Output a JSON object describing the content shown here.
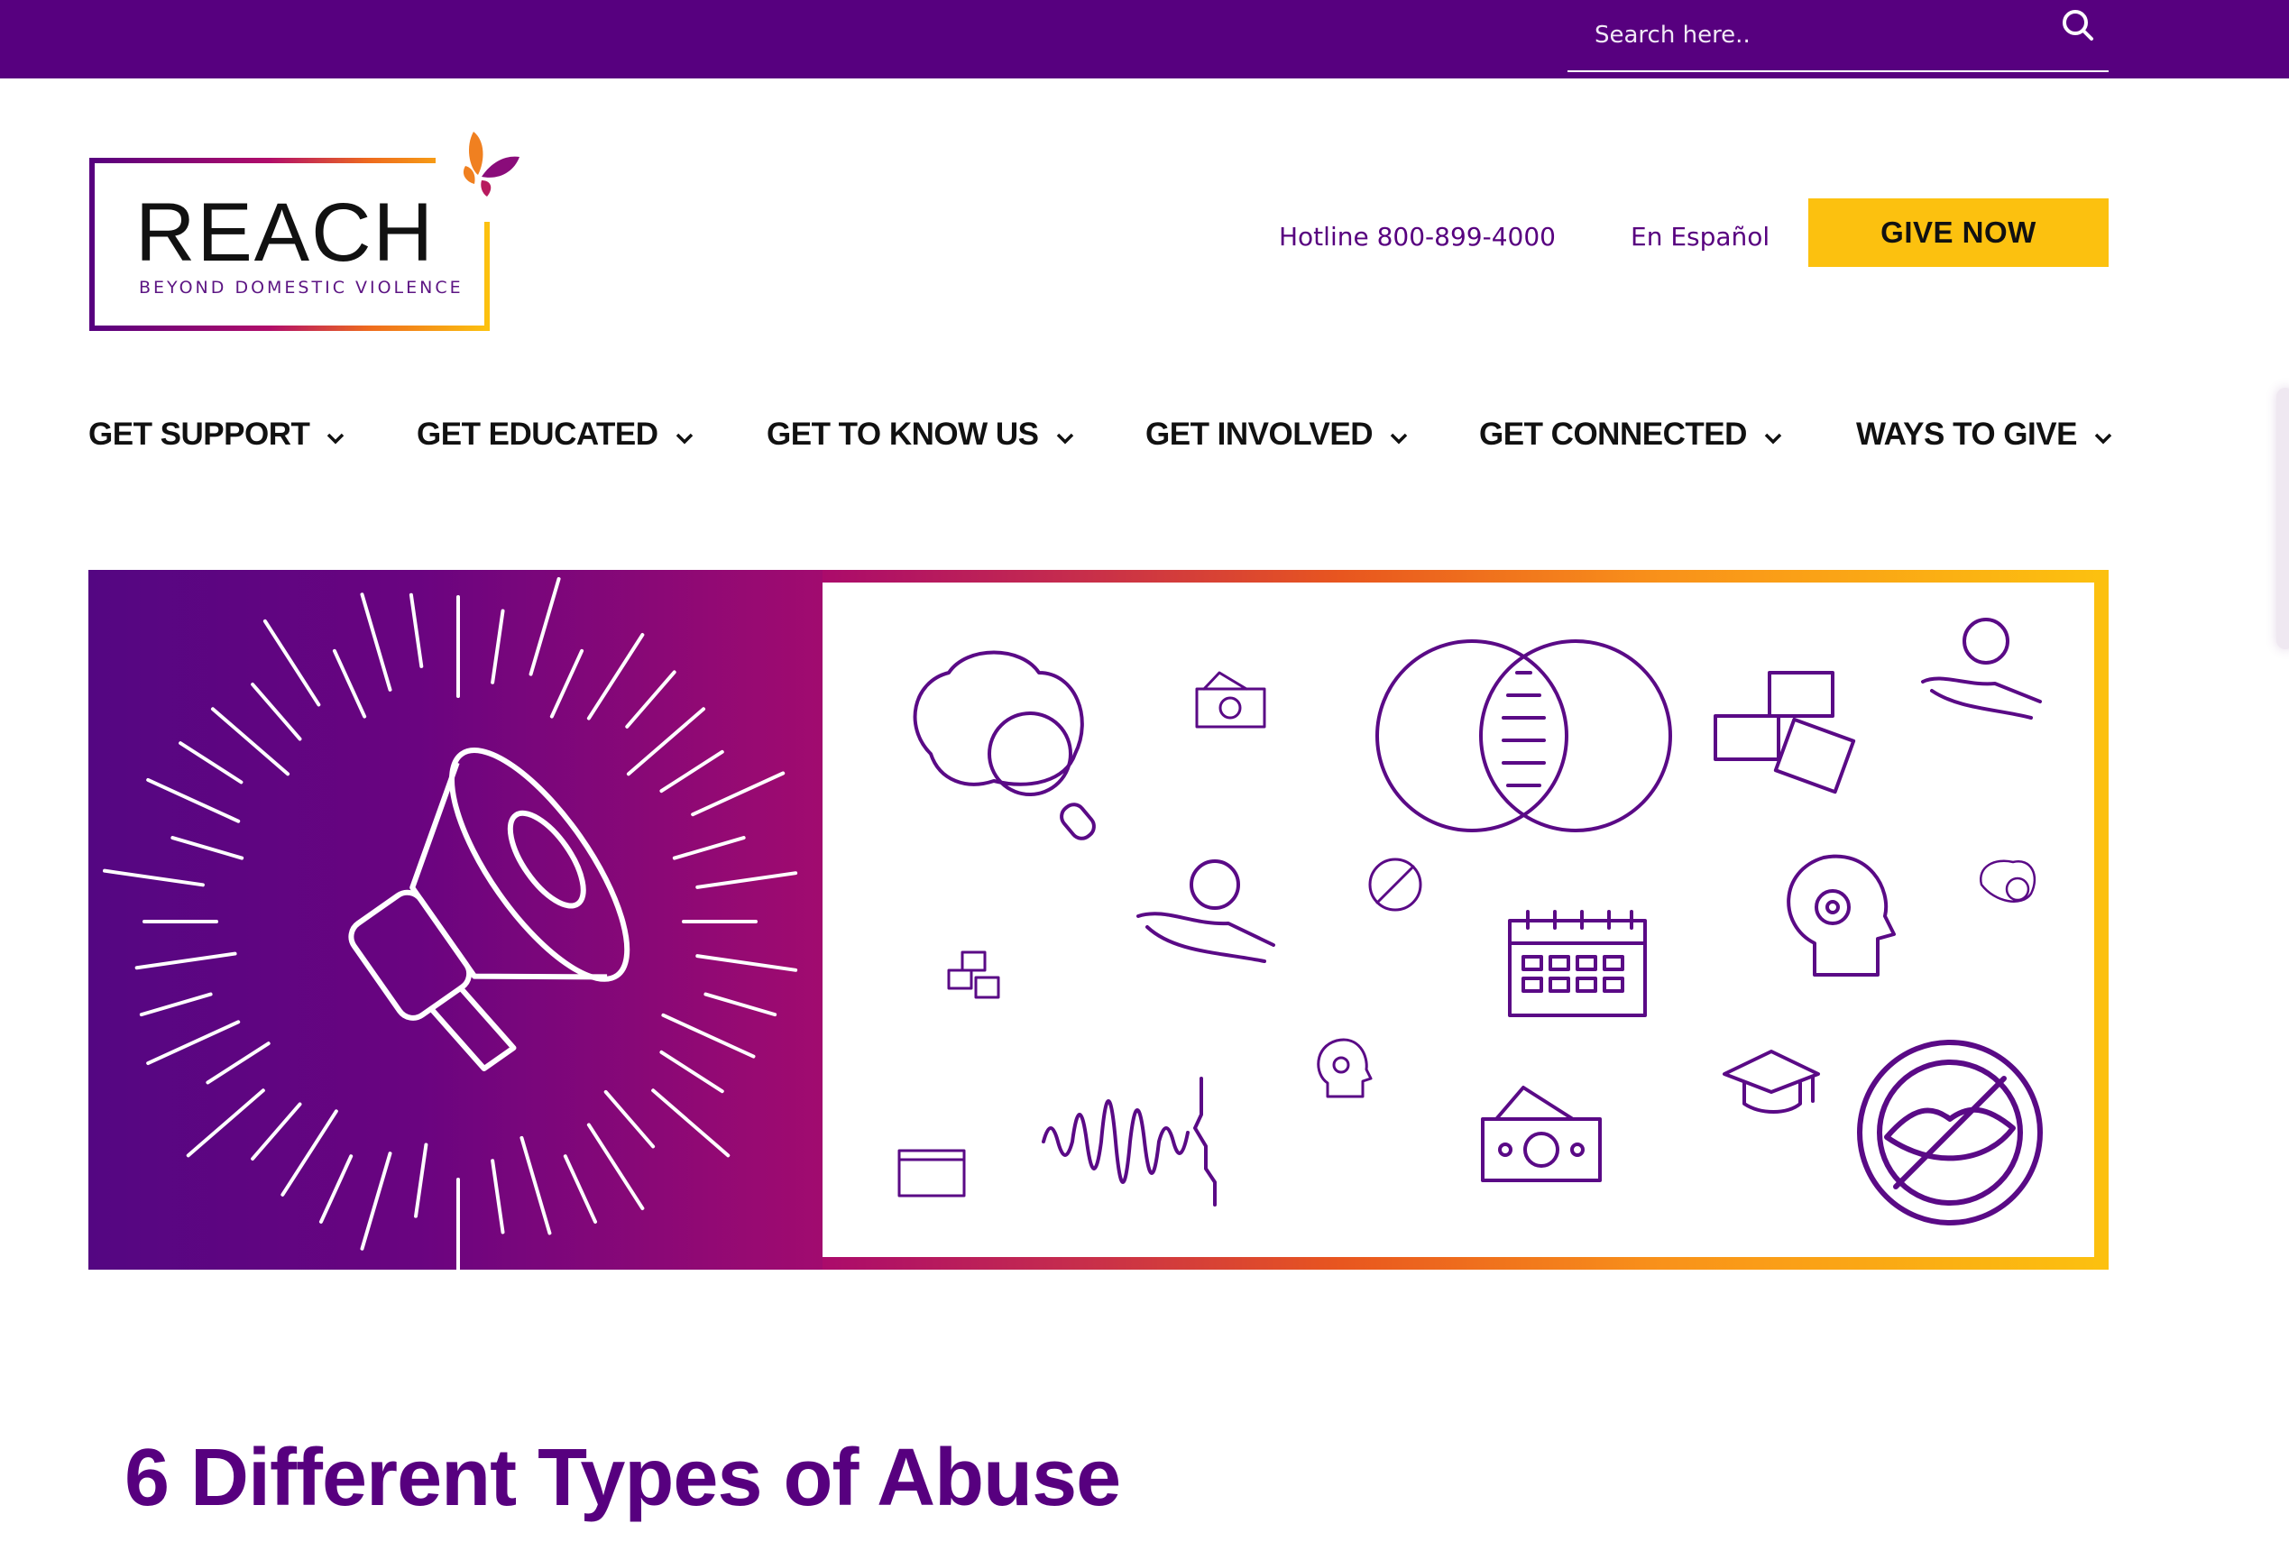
{
  "top_bar": {
    "search": {
      "placeholder": "Search here..",
      "value": "",
      "icon": "search-icon"
    }
  },
  "header": {
    "logo": {
      "wordmark": "REACH",
      "tagline": "BEYOND DOMESTIC VIOLENCE",
      "icon": "butterfly-icon"
    },
    "hotline_label": "Hotline 800-899-4000",
    "spanish_label": "En Español",
    "give_now_label": "GIVE NOW"
  },
  "nav": {
    "items": [
      {
        "label": "GET SUPPORT",
        "icon": "chevron-down-icon"
      },
      {
        "label": "GET EDUCATED",
        "icon": "chevron-down-icon"
      },
      {
        "label": "GET TO KNOW US",
        "icon": "chevron-down-icon"
      },
      {
        "label": "GET INVOLVED",
        "icon": "chevron-down-icon"
      },
      {
        "label": "GET CONNECTED",
        "icon": "chevron-down-icon"
      },
      {
        "label": "WAYS TO GIVE",
        "icon": "chevron-down-icon"
      }
    ]
  },
  "banner": {
    "left_icon": "megaphone-icon",
    "panel_icons": [
      "brain-magnifier-icon",
      "money-icon",
      "venn-diagram-icon",
      "puzzle-icon",
      "hand-coin-icon",
      "no-kissing-icon",
      "calendar-icon",
      "spiral-head-icon",
      "graduation-cap-icon",
      "sound-wave-face-icon"
    ]
  },
  "colors": {
    "brand_purple": "#57007f",
    "give_yellow": "#fcc10f"
  },
  "page": {
    "title": "6 Different Types of Abuse"
  }
}
